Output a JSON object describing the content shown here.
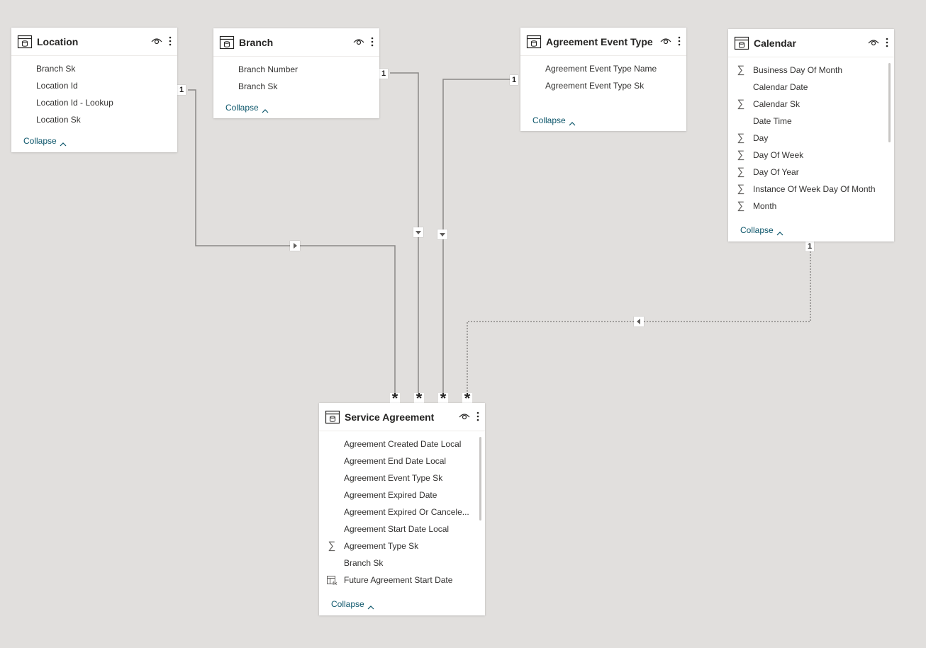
{
  "tables": {
    "location": {
      "title": "Location",
      "fields": [
        {
          "label": "Branch Sk",
          "icon": ""
        },
        {
          "label": "Location Id",
          "icon": ""
        },
        {
          "label": "Location Id - Lookup",
          "icon": ""
        },
        {
          "label": "Location Sk",
          "icon": ""
        }
      ],
      "collapse_label": "Collapse"
    },
    "branch": {
      "title": "Branch",
      "fields": [
        {
          "label": "Branch Number",
          "icon": ""
        },
        {
          "label": "Branch Sk",
          "icon": ""
        }
      ],
      "collapse_label": "Collapse"
    },
    "agreement_event_type": {
      "title": "Agreement Event Type",
      "fields": [
        {
          "label": "Agreement Event Type Name",
          "icon": ""
        },
        {
          "label": "Agreement Event Type Sk",
          "icon": ""
        }
      ],
      "collapse_label": "Collapse"
    },
    "calendar": {
      "title": "Calendar",
      "fields": [
        {
          "label": "Business Day Of Month",
          "icon": "sum"
        },
        {
          "label": "Calendar Date",
          "icon": ""
        },
        {
          "label": "Calendar Sk",
          "icon": "sum"
        },
        {
          "label": "Date Time",
          "icon": ""
        },
        {
          "label": "Day",
          "icon": "sum"
        },
        {
          "label": "Day Of Week",
          "icon": "sum"
        },
        {
          "label": "Day Of Year",
          "icon": "sum"
        },
        {
          "label": "Instance Of Week Day Of Month",
          "icon": "sum"
        },
        {
          "label": "Month",
          "icon": "sum"
        }
      ],
      "collapse_label": "Collapse"
    },
    "service_agreement": {
      "title": "Service Agreement",
      "fields": [
        {
          "label": "Agreement Created Date Local",
          "icon": ""
        },
        {
          "label": "Agreement End Date Local",
          "icon": ""
        },
        {
          "label": "Agreement Event Type Sk",
          "icon": ""
        },
        {
          "label": "Agreement Expired Date",
          "icon": ""
        },
        {
          "label": "Agreement Expired Or Cancele...",
          "icon": ""
        },
        {
          "label": "Agreement Start Date Local",
          "icon": ""
        },
        {
          "label": "Agreement Type Sk",
          "icon": "sum"
        },
        {
          "label": "Branch Sk",
          "icon": ""
        },
        {
          "label": "Future Agreement Start Date",
          "icon": "calc-column"
        }
      ],
      "collapse_label": "Collapse"
    }
  },
  "relationships": {
    "one_label": "1",
    "many_label": "*"
  },
  "icons": {
    "table": "table-icon",
    "visibility": "eye-icon",
    "more": "more-options-icon",
    "sum": "sigma-icon",
    "calc": "calculated-column-icon",
    "collapse": "chevron-up-icon"
  },
  "colors": {
    "canvas": "#e1dfdd",
    "link": "#0b556a",
    "line": "#8a8886"
  }
}
